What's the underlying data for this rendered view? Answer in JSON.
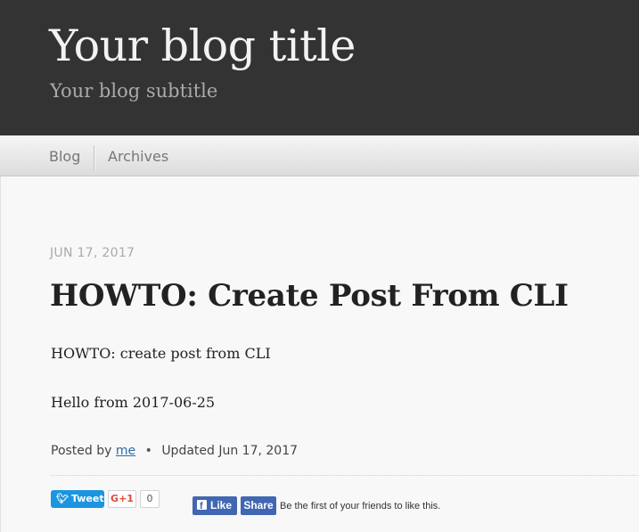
{
  "header": {
    "title": "Your blog title",
    "subtitle": "Your blog subtitle"
  },
  "nav": {
    "items": [
      {
        "label": "Blog"
      },
      {
        "label": "Archives"
      }
    ]
  },
  "post": {
    "date": "JUN 17, 2017",
    "title": "HOWTO: Create Post From CLI",
    "paragraphs": [
      "HOWTO: create post from CLI",
      "Hello from 2017-06-25"
    ],
    "meta": {
      "posted_by_label": "Posted by",
      "author": "me",
      "separator": "•",
      "updated_label": "Updated",
      "updated_date": "Jun 17, 2017"
    }
  },
  "social": {
    "tweet_label": "Tweet",
    "gplus_label": "G+1",
    "gplus_count": "0",
    "fb_like_label": "Like",
    "fb_share_label": "Share",
    "fb_text": "Be the first of your friends to like this."
  },
  "colors": {
    "header_bg": "#333333",
    "link": "#2b6aa8",
    "twitter": "#1b95e0",
    "facebook": "#4267b2",
    "gplus": "#dd4b39"
  }
}
